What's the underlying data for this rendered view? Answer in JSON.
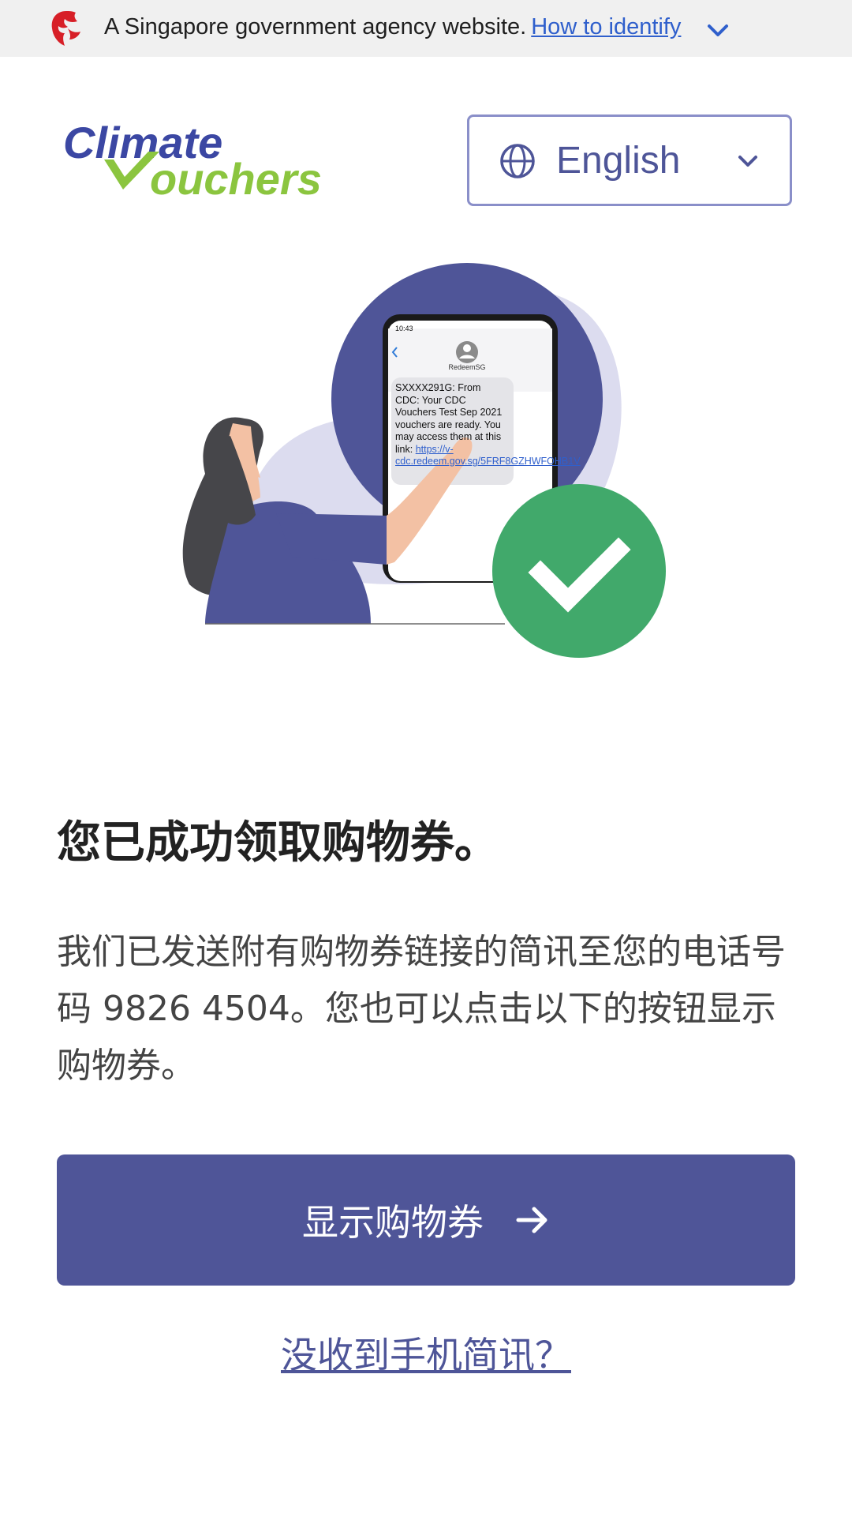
{
  "masthead": {
    "text": "A Singapore government agency website.",
    "link": "How to identify",
    "icon": "singapore-lion-icon"
  },
  "header": {
    "logo_line1": "Climate",
    "logo_line2": "ouchers",
    "language": "English"
  },
  "hero": {
    "phone_time": "10:43",
    "contact": "RedeemSG",
    "sms_body": "SXXXX291G: From CDC: Your CDC Vouchers Test Sep 2021 vouchers are ready. You may access them at this link: ",
    "sms_link": "https://v-cdc.redeem.gov.sg/5FRF8GZHWFOHB1V"
  },
  "main": {
    "title": "您已成功领取购物券。",
    "description": "我们已发送附有购物券链接的简讯至您的电话号码 9826 4504。您也可以点击以下的按钮显示购物券。",
    "button_label": "显示购物券",
    "no_sms_link": "没收到手机简讯？"
  },
  "colors": {
    "primary": "#4f5598",
    "success": "#41a96b",
    "link": "#2f5fcc",
    "logo_blue": "#3b47a3",
    "logo_green": "#8bc53f"
  }
}
